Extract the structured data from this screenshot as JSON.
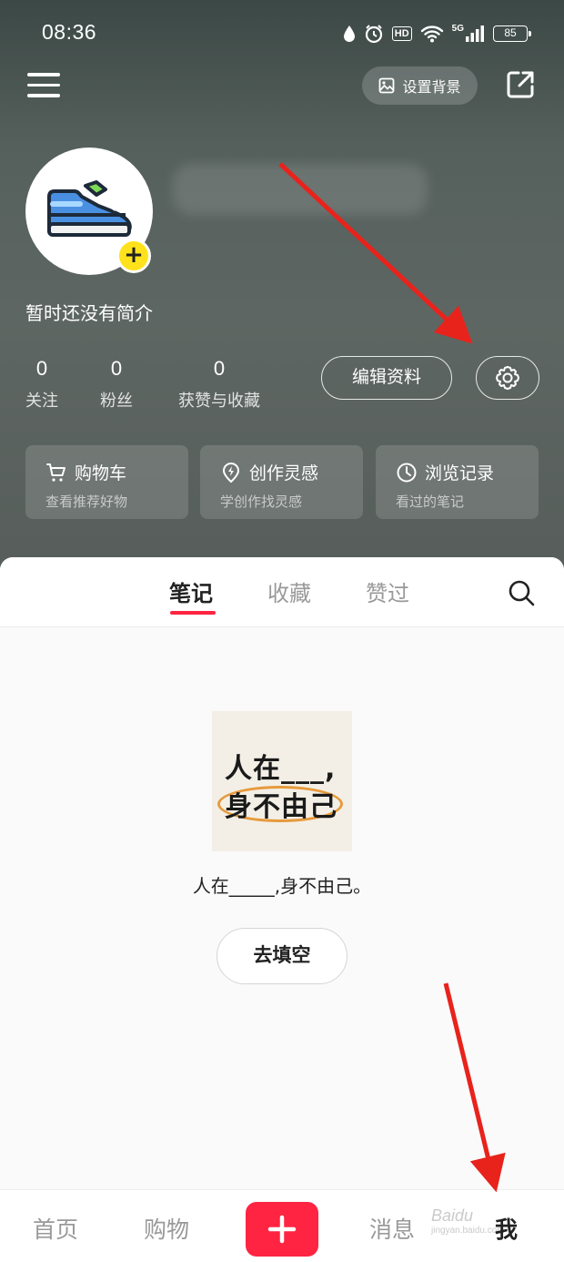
{
  "status_bar": {
    "time": "08:36",
    "hd_label": "HD",
    "network": "5G",
    "battery": "85"
  },
  "toolbar": {
    "set_background_label": "设置背景"
  },
  "profile": {
    "bio": "暂时还没有简介"
  },
  "stats": [
    {
      "value": "0",
      "label": "关注"
    },
    {
      "value": "0",
      "label": "粉丝"
    },
    {
      "value": "0",
      "label": "获赞与收藏"
    }
  ],
  "actions": {
    "edit_profile_label": "编辑资料"
  },
  "quick_cards": [
    {
      "title": "购物车",
      "subtitle": "查看推荐好物",
      "icon": "cart-icon"
    },
    {
      "title": "创作灵感",
      "subtitle": "学创作找灵感",
      "icon": "bolt-pin-icon"
    },
    {
      "title": "浏览记录",
      "subtitle": "看过的笔记",
      "icon": "clock-icon"
    }
  ],
  "tabs": [
    {
      "label": "笔记",
      "active": true
    },
    {
      "label": "收藏",
      "active": false
    },
    {
      "label": "赞过",
      "active": false
    }
  ],
  "promo": {
    "image_line1": "人在___,",
    "image_line2": "身不由己",
    "caption": "人在_____,身不由己。",
    "button_label": "去填空"
  },
  "bottom_nav": [
    {
      "label": "首页",
      "active": false
    },
    {
      "label": "购物",
      "active": false
    },
    {
      "label": "消息",
      "active": false
    },
    {
      "label": "我",
      "active": true
    }
  ],
  "watermark": {
    "brand": "Baidu",
    "sub": "jingyan.baidu.com"
  },
  "colors": {
    "accent": "#ff2442",
    "badge_yellow": "#ffe21c",
    "arrow_red": "#e8231c"
  }
}
